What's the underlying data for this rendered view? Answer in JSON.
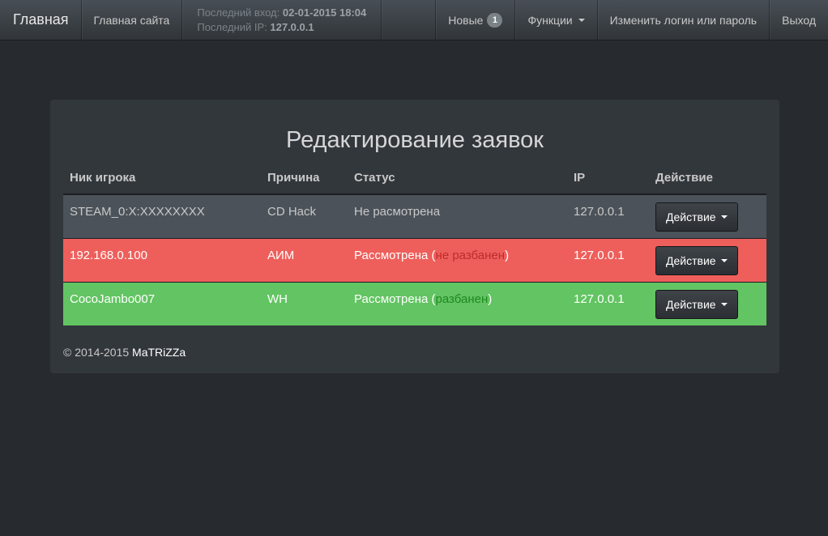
{
  "navbar": {
    "brand": "Главная",
    "site_link": "Главная сайта",
    "last_login_label": "Последний вход:",
    "last_login_value": "02-01-2015 18:04",
    "last_ip_label": "Последний IP:",
    "last_ip_value": "127.0.0.1",
    "new_label": "Новые",
    "new_count": "1",
    "functions_label": "Функции",
    "change_login_label": "Изменить логин или пароль",
    "logout_label": "Выход"
  },
  "panel": {
    "title": "Редактирование заявок",
    "columns": [
      "Ник игрока",
      "Причина",
      "Статус",
      "IP",
      "Действие"
    ],
    "rows": [
      {
        "nick": "STEAM_0:X:XXXXXXXX",
        "reason": "CD Hack",
        "status": "Не расмотрена",
        "status_note": "",
        "ip": "127.0.0.1",
        "action": "Действие"
      },
      {
        "nick": "192.168.0.100",
        "reason": "АИМ",
        "status": "Рассмотрена (",
        "status_note": "не разбанен",
        "status_close": ")",
        "ip": "127.0.0.1",
        "action": "Действие"
      },
      {
        "nick": "CocoJambo007",
        "reason": "WH",
        "status": "Рассмотрена (",
        "status_note": "разбанен",
        "status_close": ")",
        "ip": "127.0.0.1",
        "action": "Действие"
      }
    ]
  },
  "footer": {
    "copyright": "© 2014-2015",
    "author": "MaTRiZZa"
  },
  "colors": {
    "background": "#272b30",
    "row_danger": "#ee5f5b",
    "row_success": "#62c462",
    "row_default": "#4b5259"
  },
  "icons": {
    "dropdown": "caret-down-icon"
  }
}
